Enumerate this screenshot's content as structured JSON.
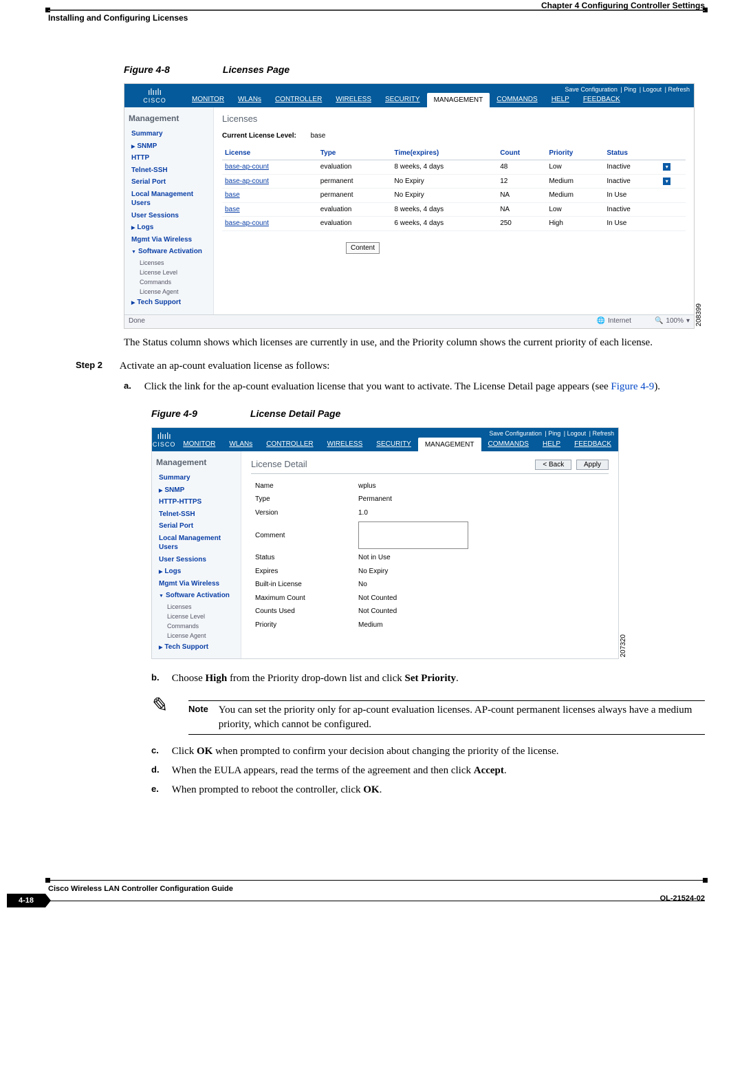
{
  "header": {
    "chapter": "Chapter 4      Configuring Controller Settings",
    "section": "Installing and Configuring Licenses"
  },
  "figure48": {
    "caption_num": "Figure 4-8",
    "caption_title": "Licenses Page",
    "side_id": "208399",
    "cisco_brand": "CISCO",
    "top_links": [
      "Save Configuration",
      "Ping",
      "Logout",
      "Refresh"
    ],
    "tabs": [
      "MONITOR",
      "WLANs",
      "CONTROLLER",
      "WIRELESS",
      "SECURITY",
      "MANAGEMENT",
      "COMMANDS",
      "HELP",
      "FEEDBACK"
    ],
    "active_tab_index": 5,
    "sidenav": {
      "heading": "Management",
      "items": [
        {
          "label": "Summary",
          "type": "item"
        },
        {
          "label": "SNMP",
          "type": "arrow"
        },
        {
          "label": "HTTP",
          "type": "item"
        },
        {
          "label": "Telnet-SSH",
          "type": "item"
        },
        {
          "label": "Serial Port",
          "type": "item"
        },
        {
          "label": "Local Management Users",
          "type": "item"
        },
        {
          "label": "User Sessions",
          "type": "item"
        },
        {
          "label": "Logs",
          "type": "arrow"
        },
        {
          "label": "Mgmt Via Wireless",
          "type": "item"
        },
        {
          "label": "Software Activation",
          "type": "arrow open",
          "subs": [
            "Licenses",
            "License Level",
            "Commands",
            "License Agent"
          ]
        },
        {
          "label": "Tech Support",
          "type": "arrow"
        }
      ]
    },
    "pane_title": "Licenses",
    "current_level_label": "Current License Level:",
    "current_level_value": "base",
    "columns": [
      "License",
      "Type",
      "Time(expires)",
      "Count",
      "Priority",
      "Status",
      ""
    ],
    "rows": [
      {
        "license": "base-ap-count",
        "type": "evaluation",
        "time": "8 weeks, 4 days",
        "count": "48",
        "priority": "Low",
        "status": "Inactive",
        "box": true
      },
      {
        "license": "base-ap-count",
        "type": "permanent",
        "time": "No Expiry",
        "count": "12",
        "priority": "Medium",
        "status": "Inactive",
        "box": true
      },
      {
        "license": "base",
        "type": "permanent",
        "time": "No Expiry",
        "count": "NA",
        "priority": "Medium",
        "status": "In Use",
        "box": false
      },
      {
        "license": "base",
        "type": "evaluation",
        "time": "8 weeks, 4 days",
        "count": "NA",
        "priority": "Low",
        "status": "Inactive",
        "box": false
      },
      {
        "license": "base-ap-count",
        "type": "evaluation",
        "time": "6 weeks, 4 days",
        "count": "250",
        "priority": "High",
        "status": "In Use",
        "box": false
      }
    ],
    "content_btn": "Content",
    "status_left": "Done",
    "status_internet": "Internet",
    "status_zoom": "100%"
  },
  "body_text": {
    "after_fig48": "The Status column shows which licenses are currently in use, and the Priority column shows the current priority of each license.",
    "step2_label": "Step 2",
    "step2_body": "Activate an ap-count evaluation license as follows:",
    "sub_a_label": "a.",
    "sub_a_pre": "Click the link for the ap-count evaluation license that you want to activate. The License Detail page appears (see ",
    "sub_a_xref": "Figure 4-9",
    "sub_a_post": ")."
  },
  "figure49": {
    "caption_num": "Figure 4-9",
    "caption_title": "License Detail Page",
    "side_id": "207320",
    "cisco_brand": "CISCO",
    "top_links": [
      "Save Configuration",
      "Ping",
      "Logout",
      "Refresh"
    ],
    "tabs": [
      "MONITOR",
      "WLANs",
      "CONTROLLER",
      "WIRELESS",
      "SECURITY",
      "MANAGEMENT",
      "COMMANDS",
      "HELP",
      "FEEDBACK"
    ],
    "active_tab_index": 5,
    "sidenav": {
      "heading": "Management",
      "items": [
        {
          "label": "Summary",
          "type": "item"
        },
        {
          "label": "SNMP",
          "type": "arrow"
        },
        {
          "label": "HTTP-HTTPS",
          "type": "item"
        },
        {
          "label": "Telnet-SSH",
          "type": "item"
        },
        {
          "label": "Serial Port",
          "type": "item"
        },
        {
          "label": "Local Management Users",
          "type": "item"
        },
        {
          "label": "User Sessions",
          "type": "item"
        },
        {
          "label": "Logs",
          "type": "arrow"
        },
        {
          "label": "Mgmt Via Wireless",
          "type": "item"
        },
        {
          "label": "Software Activation",
          "type": "arrow open",
          "subs": [
            "Licenses",
            "License Level",
            "Commands",
            "License Agent"
          ]
        },
        {
          "label": "Tech Support",
          "type": "arrow"
        }
      ]
    },
    "pane_title": "License Detail",
    "back_btn": "< Back",
    "apply_btn": "Apply",
    "rows": [
      {
        "label": "Name",
        "value": "wplus"
      },
      {
        "label": "Type",
        "value": "Permanent"
      },
      {
        "label": "Version",
        "value": "1.0"
      },
      {
        "label": "Comment",
        "value": "",
        "textarea": true
      },
      {
        "label": "Status",
        "value": "Not in Use"
      },
      {
        "label": "Expires",
        "value": "No Expiry"
      },
      {
        "label": "Built-in License",
        "value": "No"
      },
      {
        "label": "Maximum Count",
        "value": "Not Counted"
      },
      {
        "label": "Counts Used",
        "value": "Not Counted"
      },
      {
        "label": "Priority",
        "value": "Medium"
      }
    ]
  },
  "after49": {
    "sub_b_label": "b.",
    "sub_b_pre": "Choose ",
    "sub_b_bold1": "High",
    "sub_b_mid": " from the Priority drop-down list and click ",
    "sub_b_bold2": "Set Priority",
    "sub_b_post": ".",
    "note_label": "Note",
    "note_text": "You can set the priority only for ap-count evaluation licenses. AP-count permanent licenses always have a medium priority, which cannot be configured.",
    "sub_c_label": "c.",
    "sub_c_pre": "Click ",
    "sub_c_bold": "OK",
    "sub_c_post": " when prompted to confirm your decision about changing the priority of the license.",
    "sub_d_label": "d.",
    "sub_d_pre": "When the EULA appears, read the terms of the agreement and then click ",
    "sub_d_bold": "Accept",
    "sub_d_post": ".",
    "sub_e_label": "e.",
    "sub_e_pre": "When prompted to reboot the controller, click ",
    "sub_e_bold": "OK",
    "sub_e_post": "."
  },
  "footer": {
    "guide": "Cisco Wireless LAN Controller Configuration Guide",
    "page": "4-18",
    "doc": "OL-21524-02"
  }
}
